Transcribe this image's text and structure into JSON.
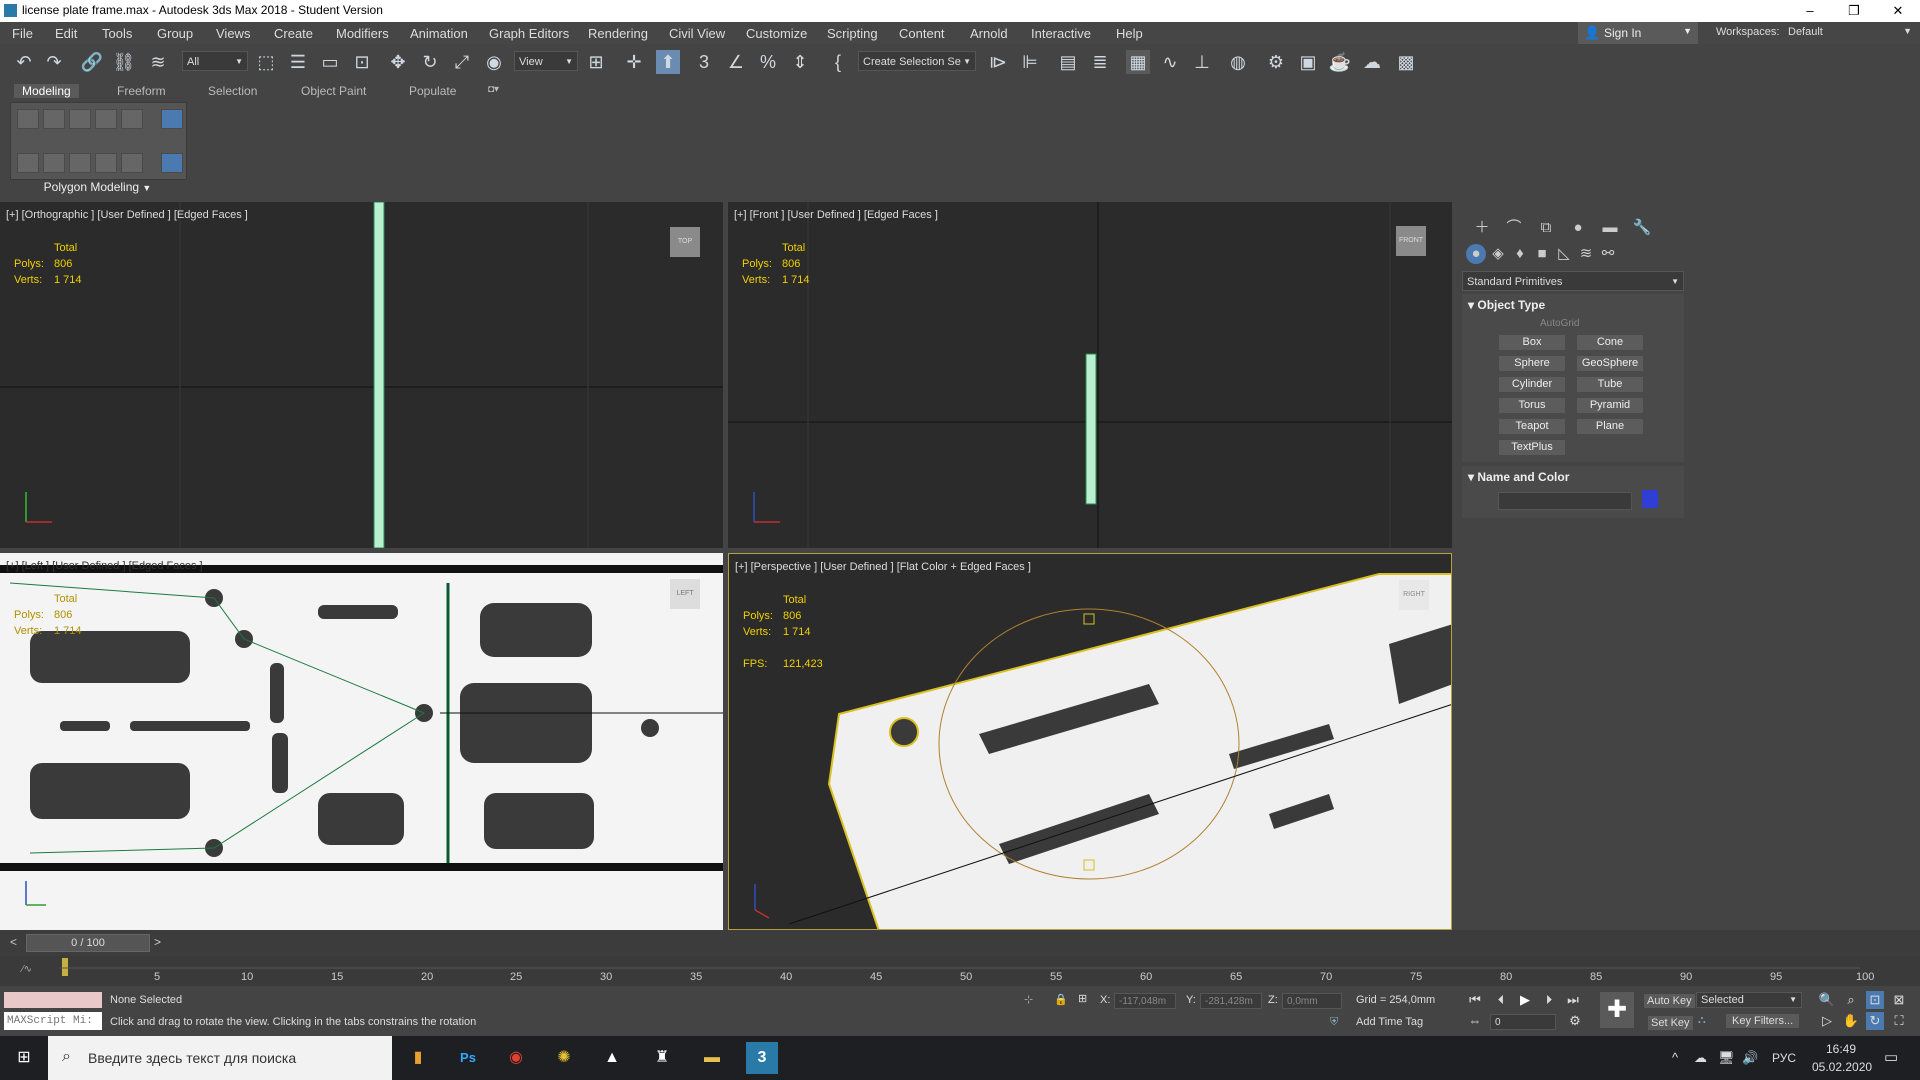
{
  "window": {
    "title": "license plate frame.max - Autodesk 3ds Max 2018 - Student Version",
    "minimize": "–",
    "maximize": "❐",
    "close": "✕"
  },
  "menubar": {
    "items": [
      "File",
      "Edit",
      "Tools",
      "Group",
      "Views",
      "Create",
      "Modifiers",
      "Animation",
      "Graph Editors",
      "Rendering",
      "Civil View",
      "Customize",
      "Scripting",
      "Content",
      "Arnold",
      "Interactive",
      "Help"
    ],
    "sign_in": "Sign In",
    "workspaces_label": "Workspaces:",
    "workspaces_value": "Default"
  },
  "toolbar": {
    "filter_value": "All",
    "refcoord_value": "View",
    "selection_set_value": "Create Selection Se"
  },
  "ribbon": {
    "tabs": [
      "Modeling",
      "Freeform",
      "Selection",
      "Object Paint",
      "Populate"
    ],
    "active_tab": "Modeling",
    "panel_label": "Polygon Modeling"
  },
  "viewports": {
    "top_left": {
      "label": "[+] [Orthographic ] [User Defined ] [Edged Faces ]",
      "cube": "TOP"
    },
    "top_right": {
      "label": "[+] [Front ] [User Defined ] [Edged Faces ]",
      "cube": "FRONT"
    },
    "bottom_left": {
      "label": "[+] [Left ] [User Defined ] [Edged Faces ]",
      "cube": "LEFT"
    },
    "bottom_right": {
      "label": "[+] [Perspective ] [User Defined ] [Flat Color + Edged Faces ]",
      "cube": "RIGHT"
    },
    "stats": {
      "total_label": "Total",
      "polys_label": "Polys:",
      "polys_value": "806",
      "verts_label": "Verts:",
      "verts_value": "1 714",
      "fps_label": "FPS:",
      "fps_value": "121,423"
    }
  },
  "command_panel": {
    "category": "Standard Primitives",
    "object_type_title": "Object Type",
    "autogrid": "AutoGrid",
    "buttons": [
      "Box",
      "Cone",
      "Sphere",
      "GeoSphere",
      "Cylinder",
      "Tube",
      "Torus",
      "Pyramid",
      "Teapot",
      "Plane",
      "TextPlus"
    ],
    "name_color_title": "Name and Color",
    "object_color": "#2f3ed4"
  },
  "timeline": {
    "frame_counter": "0 / 100",
    "prev": "<",
    "next": ">",
    "ticks": [
      "5",
      "10",
      "15",
      "20",
      "25",
      "30",
      "35",
      "40",
      "45",
      "50",
      "55",
      "60",
      "65",
      "70",
      "75",
      "80",
      "85",
      "90",
      "95",
      "100"
    ]
  },
  "status": {
    "maxscript": "MAXScript Mi:",
    "selection": "None Selected",
    "prompt": "Click and drag to rotate the view.  Clicking in the tabs constrains the rotation",
    "x_label": "X:",
    "x_value": "-117,048m",
    "y_label": "Y:",
    "y_value": "-281,428m",
    "z_label": "Z:",
    "z_value": "0,0mm",
    "grid": "Grid = 254,0mm",
    "add_time_tag": "Add Time Tag",
    "auto_key": "Auto Key",
    "set_key": "Set Key",
    "key_mode_value": "Selected",
    "key_filters": "Key Filters...",
    "frame_value": "0"
  },
  "taskbar": {
    "search_placeholder": "Введите здесь текст для поиска",
    "language": "РУС",
    "time": "16:49",
    "date": "05.02.2020"
  }
}
